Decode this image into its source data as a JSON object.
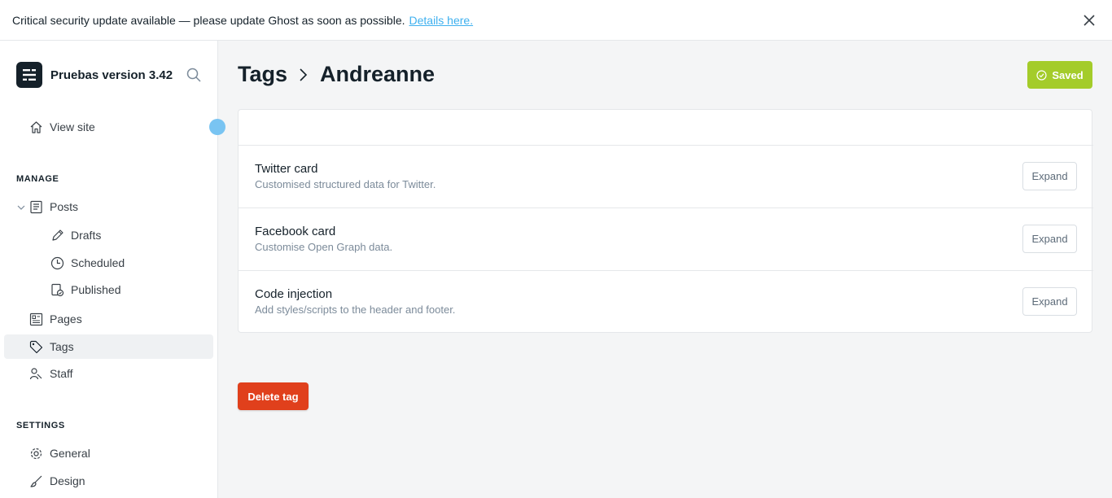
{
  "banner": {
    "message": "Critical security update available — please update Ghost as soon as possible.",
    "link_text": "Details here."
  },
  "sidebar": {
    "site_name": "Pruebas version 3.42",
    "view_site": "View site",
    "manage_heading": "MANAGE",
    "settings_heading": "SETTINGS",
    "items": {
      "posts": "Posts",
      "drafts": "Drafts",
      "scheduled": "Scheduled",
      "published": "Published",
      "pages": "Pages",
      "tags": "Tags",
      "staff": "Staff",
      "general": "General",
      "design": "Design"
    }
  },
  "header": {
    "breadcrumb_parent": "Tags",
    "breadcrumb_current": "Andreanne",
    "saved_label": "Saved"
  },
  "sections": [
    {
      "title": "Twitter card",
      "description": "Customised structured data for Twitter.",
      "button": "Expand"
    },
    {
      "title": "Facebook card",
      "description": "Customise Open Graph data.",
      "button": "Expand"
    },
    {
      "title": "Code injection",
      "description": "Add styles/scripts to the header and footer.",
      "button": "Expand"
    }
  ],
  "delete_label": "Delete tag",
  "colors": {
    "saved_green": "#a4cc2a",
    "delete_red": "#e0401c",
    "link_blue": "#3eb0ef"
  }
}
